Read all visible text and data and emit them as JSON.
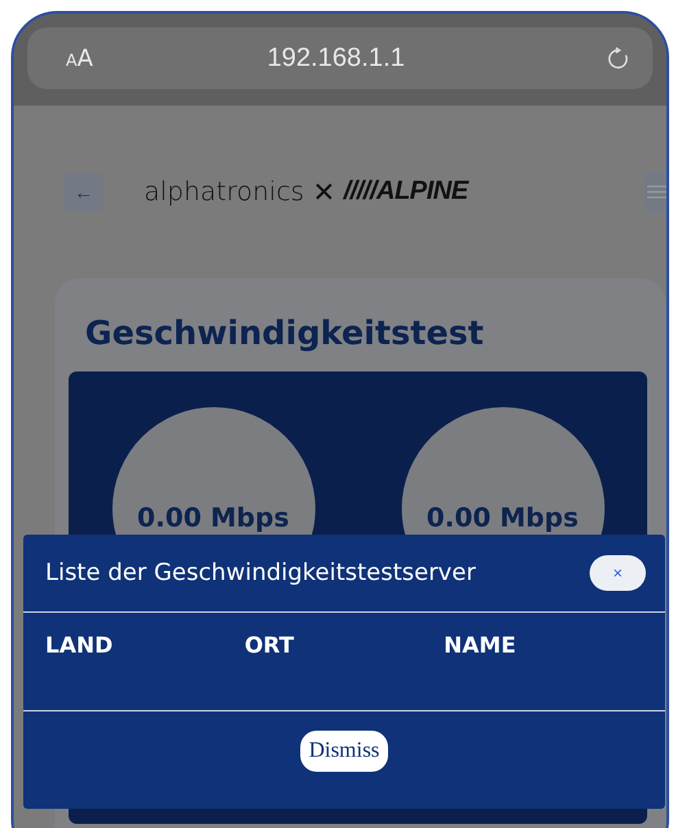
{
  "browser_bar": {
    "text_size_button": "AA",
    "url": "192.168.1.1"
  },
  "header": {
    "back_button": "←",
    "logo_left": "alphatronics",
    "logo_separator": "✕",
    "logo_right": "/////ALPINE"
  },
  "speed_test": {
    "title": "Geschwindigkeitstest",
    "gauges": [
      {
        "reading": "0.00 Mbps"
      },
      {
        "reading": "0.00 Mbps"
      }
    ]
  },
  "modal": {
    "title": "Liste der Geschwindigkeitstestserver",
    "close_button": "×",
    "columns": [
      "LAND",
      "ORT",
      "NAME"
    ],
    "dismiss_button": "Dismiss"
  }
}
